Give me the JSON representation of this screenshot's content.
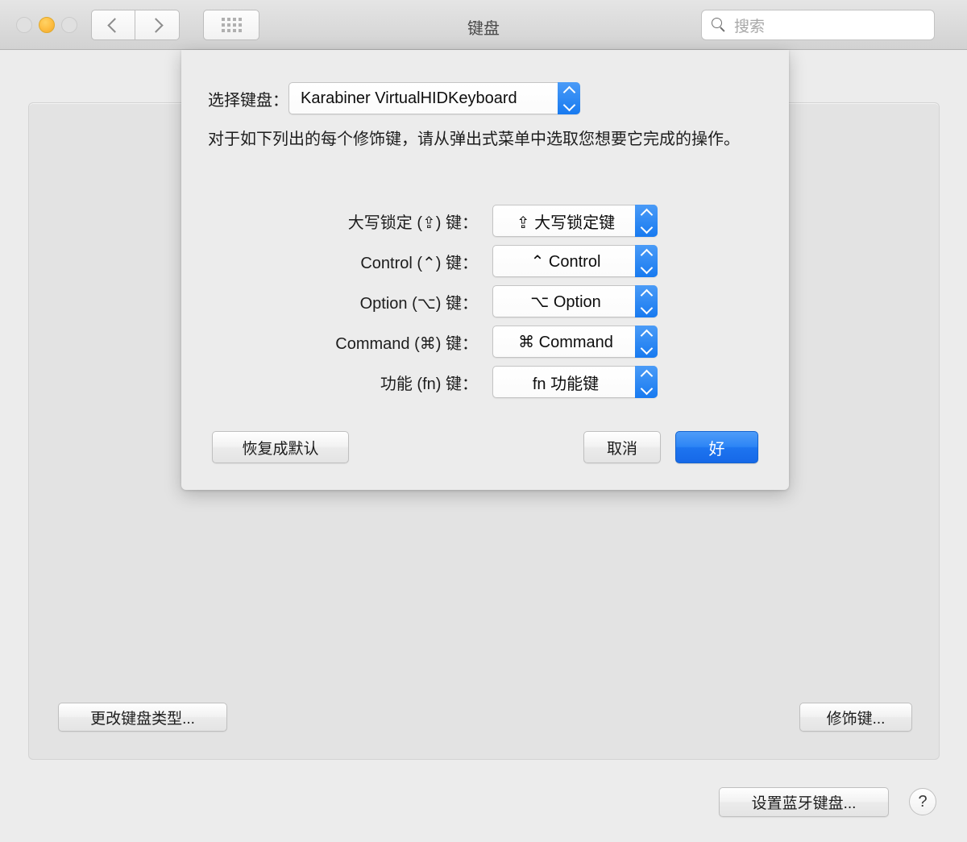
{
  "window": {
    "title": "键盘",
    "traffic_lights": [
      {
        "name": "close",
        "state": "disabled"
      },
      {
        "name": "minimize",
        "state": "active",
        "color": "#fdbc40"
      },
      {
        "name": "zoom",
        "state": "disabled"
      }
    ],
    "nav": {
      "back": "‹",
      "forward": "›",
      "grid": "grid-icon"
    },
    "search": {
      "placeholder": "搜索",
      "value": "",
      "icon": "search-icon"
    }
  },
  "sheet": {
    "keyboard_select": {
      "label": "选择键盘：",
      "value": "Karabiner VirtualHIDKeyboard"
    },
    "description": "对于如下列出的每个修饰键，请从弹出式菜单中选取您想要它完成的操作。",
    "modifier_rows": [
      {
        "label": "大写锁定 (⇪) 键：",
        "value": "⇪ 大写锁定键"
      },
      {
        "label": "Control (⌃) 键：",
        "value": "⌃ Control"
      },
      {
        "label": "Option (⌥) 键：",
        "value": "⌥ Option"
      },
      {
        "label": "Command (⌘) 键：",
        "value": "⌘ Command"
      },
      {
        "label": "功能 (fn) 键：",
        "value": "fn 功能键"
      }
    ],
    "buttons": {
      "restore_defaults": "恢复成默认",
      "cancel": "取消",
      "ok": "好"
    }
  },
  "pane": {
    "change_keyboard_type": "更改键盘类型...",
    "modifier_keys": "修饰键...",
    "setup_bluetooth_keyboard": "设置蓝牙键盘...",
    "help": "?"
  },
  "colors": {
    "accent_blue": "#1d74ef",
    "amber": "#fdbc40",
    "window_bg": "#ececec",
    "pane_bg": "#e3e3e3"
  }
}
